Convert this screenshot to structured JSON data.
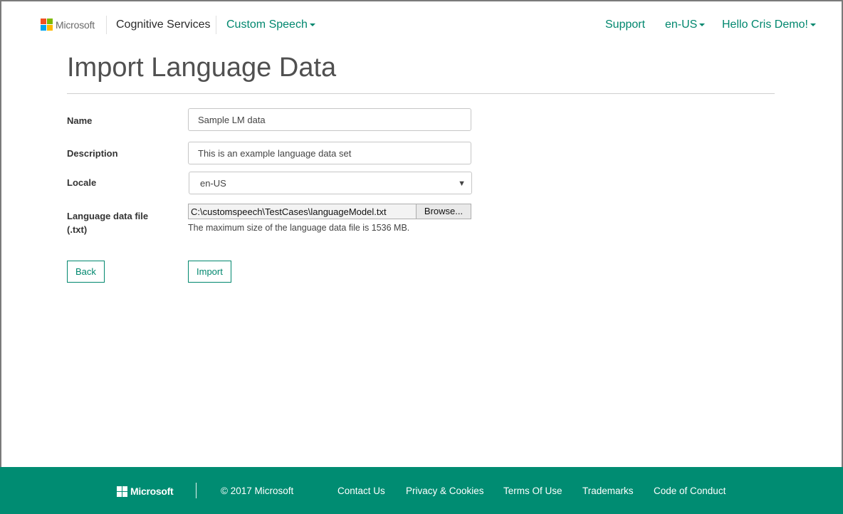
{
  "header": {
    "brand_label": "Microsoft",
    "service_label": "Cognitive Services",
    "product_label": "Custom Speech",
    "support_label": "Support",
    "locale_label": "en-US",
    "user_label": "Hello Cris Demo!"
  },
  "page": {
    "title": "Import Language Data"
  },
  "form": {
    "name_label": "Name",
    "name_value": "Sample LM data",
    "description_label": "Description",
    "description_value": "This is an example language data set",
    "locale_label": "Locale",
    "locale_value": "en-US",
    "file_label_line1": "Language data file",
    "file_label_line2": "(.txt)",
    "file_path": "C:\\customspeech\\TestCases\\languageModel.txt",
    "browse_label": "Browse...",
    "file_hint": "The maximum size of the language data file is 1536 MB.",
    "back_label": "Back",
    "import_label": "Import"
  },
  "footer": {
    "brand_label": "Microsoft",
    "copyright": "© 2017 Microsoft",
    "links": [
      "Contact Us",
      "Privacy & Cookies",
      "Terms Of Use",
      "Trademarks",
      "Code of Conduct"
    ]
  },
  "colors": {
    "accent": "#00876e",
    "footer_bg": "#008c72",
    "logo_red": "#f25022",
    "logo_green": "#7fba00",
    "logo_blue": "#00a4ef",
    "logo_yellow": "#ffb900"
  },
  "icons": {
    "brand": "microsoft-logo-icon",
    "dropdown": "caret-down-icon",
    "select": "select-arrow-icon"
  }
}
